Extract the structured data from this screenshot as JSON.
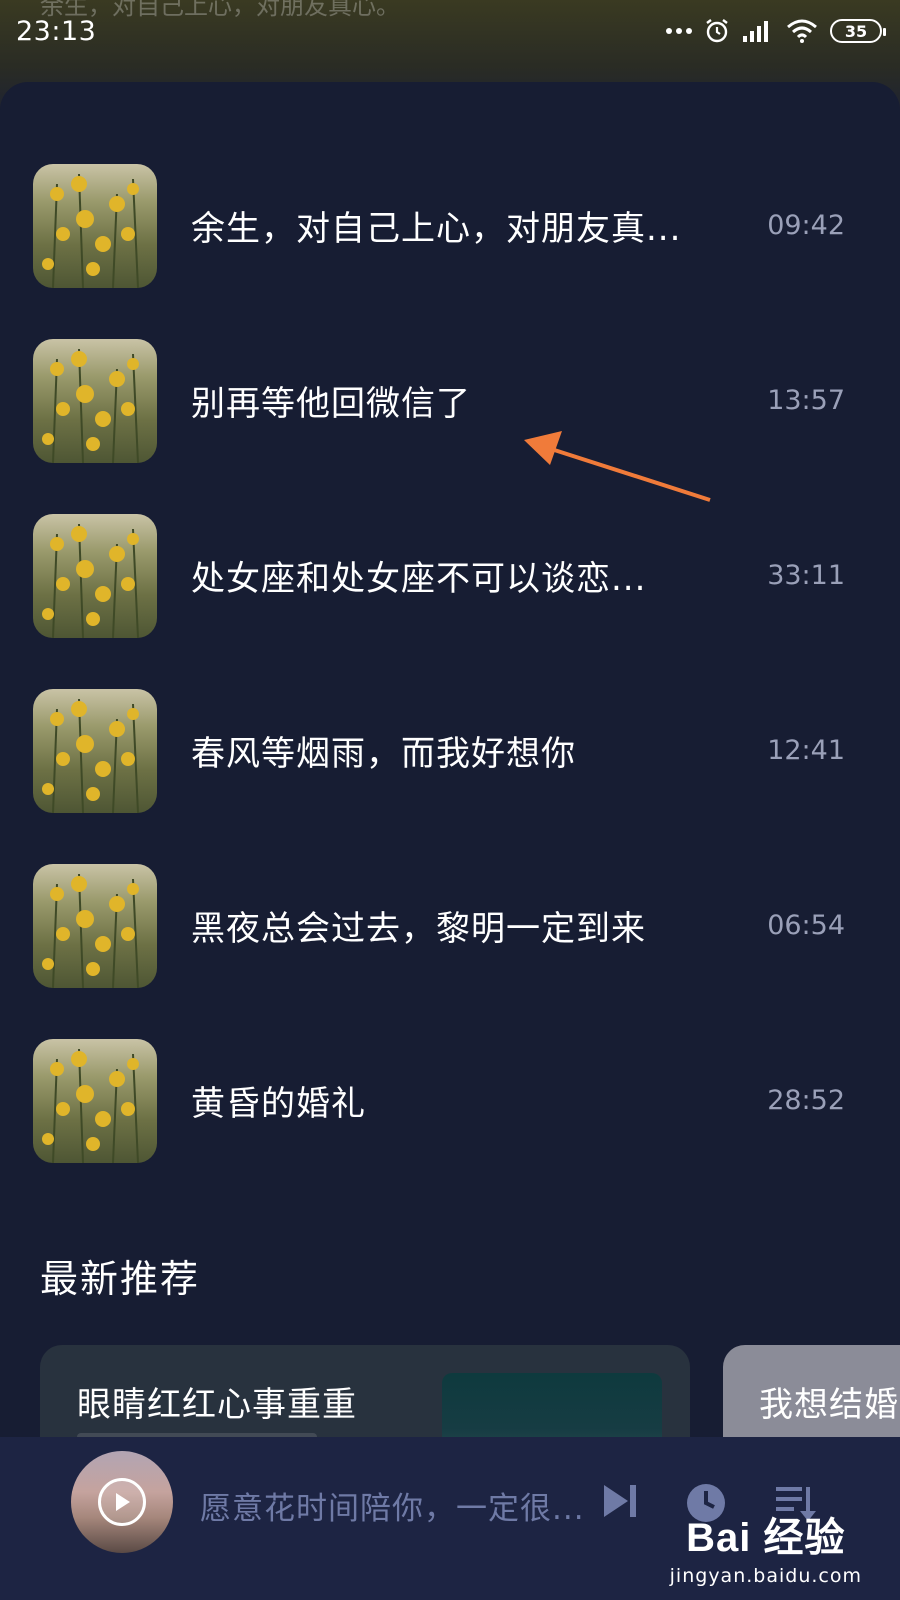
{
  "status_bar": {
    "time": "23:13",
    "battery": "35",
    "icons": [
      "more-dots-icon",
      "alarm-icon",
      "signal-icon",
      "wifi-icon",
      "battery-icon"
    ]
  },
  "background": {
    "ghost_title": "余生，对自己上心，对朋友真心。"
  },
  "list": {
    "items": [
      {
        "title": "余生，对自己上心，对朋友真...",
        "duration": "09:42"
      },
      {
        "title": "别再等他回微信了",
        "duration": "13:57"
      },
      {
        "title": "处女座和处女座不可以谈恋...",
        "duration": "33:11"
      },
      {
        "title": "春风等烟雨，而我好想你",
        "duration": "12:41"
      },
      {
        "title": "黑夜总会过去，黎明一定到来",
        "duration": "06:54"
      },
      {
        "title": "黄昏的婚礼",
        "duration": "28:52"
      }
    ]
  },
  "recommend": {
    "section_title": "最新推荐",
    "cards": [
      {
        "title": "眼睛红红心事重重"
      },
      {
        "title": "我想结婚"
      }
    ]
  },
  "player": {
    "now_playing": "愿意花时间陪你，一定很..."
  },
  "watermark": {
    "logo": "Bai 经验",
    "url": "jingyan.baidu.com"
  },
  "colors": {
    "background": "#171d33",
    "player_bar": "#1d2443",
    "annotation_arrow": "#f07b3a",
    "duration_text": "#9aa0b8",
    "player_text": "#6f7aa6"
  }
}
